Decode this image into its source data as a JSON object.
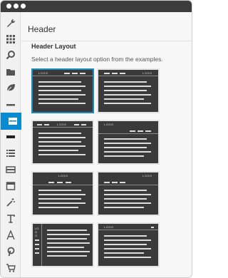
{
  "main": {
    "title": "Header",
    "section_title": "Header Layout",
    "section_desc": "Select a header layout option from the examples."
  },
  "sidebar": {
    "icons": [
      "wrench-icon",
      "grid-icon",
      "search-icon",
      "folder-icon",
      "leaf-icon",
      "divider-icon",
      "header-icon",
      "footer-icon",
      "list-icon",
      "menu-bar-icon",
      "window-icon",
      "magic-wand-icon",
      "text-icon",
      "font-icon",
      "pinterest-icon",
      "cart-icon"
    ],
    "active": "header-icon"
  },
  "layouts": [
    {
      "logo": "LOGO",
      "selected": true
    },
    {
      "logo": "LOGO"
    },
    {
      "logo": "LOGO"
    },
    {
      "logo": "LOGO"
    },
    {
      "logo": "LOGO"
    },
    {
      "logo": "LOGO"
    },
    {
      "logo": "LOGO"
    },
    {
      "logo": "LOGO"
    }
  ],
  "colors": {
    "accent": "#0a8ad1",
    "thumb": "#3a3a3a"
  }
}
